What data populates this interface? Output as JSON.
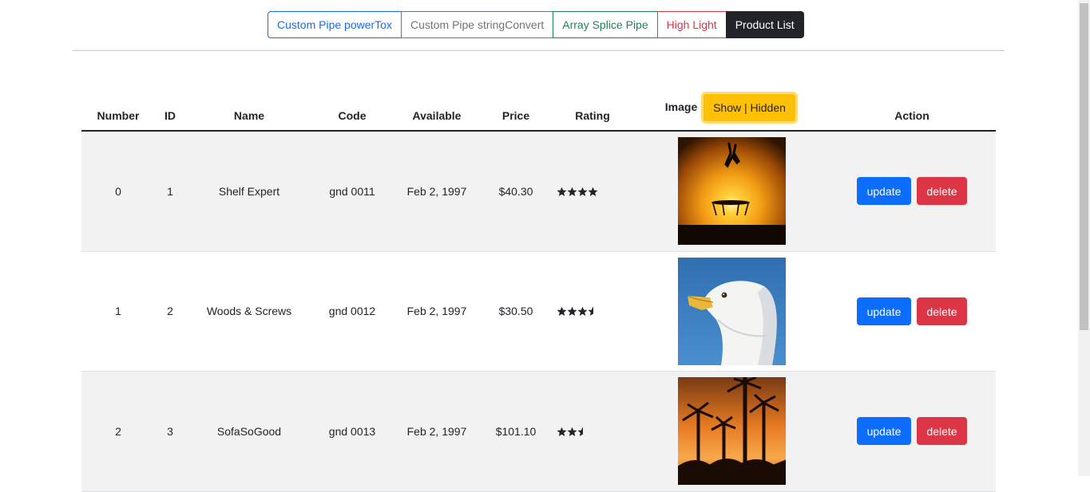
{
  "nav": {
    "tabs": [
      {
        "label": "Custom Pipe powerTox"
      },
      {
        "label": "Custom Pipe stringConvert"
      },
      {
        "label": "Array Splice Pipe"
      },
      {
        "label": "High Light"
      },
      {
        "label": "Product List"
      }
    ],
    "active": "Product List"
  },
  "table": {
    "headers": {
      "number": "Number",
      "id": "ID",
      "name": "Name",
      "code": "Code",
      "available": "Available",
      "price": "Price",
      "rating": "Rating",
      "image": "Image",
      "action": "Action"
    },
    "toggle_label": "Show | Hidden",
    "rows": [
      {
        "number": "0",
        "id": "1",
        "name": "Shelf Expert",
        "code": "gnd 0011",
        "available": "Feb 2, 1997",
        "price": "$40.30",
        "rating": 4,
        "image": "silhouette jumping on trampoline at sunset",
        "update_label": "update",
        "delete_label": "delete"
      },
      {
        "number": "1",
        "id": "2",
        "name": "Woods & Screws",
        "code": "gnd 0012",
        "available": "Feb 2, 1997",
        "price": "$30.50",
        "rating": 3.5,
        "image": "seagull head against blue sky",
        "update_label": "update",
        "delete_label": "delete"
      },
      {
        "number": "2",
        "id": "3",
        "name": "SofaSoGood",
        "code": "gnd 0013",
        "available": "Feb 2, 1997",
        "price": "$101.10",
        "rating": 2.5,
        "image": "palm trees at orange sunset",
        "update_label": "update",
        "delete_label": "delete"
      }
    ]
  },
  "colors": {
    "primary": "#0d6efd",
    "danger": "#dc3545",
    "warning": "#ffc107",
    "dark": "#212529",
    "success": "#198754",
    "secondary": "#6c757d"
  }
}
